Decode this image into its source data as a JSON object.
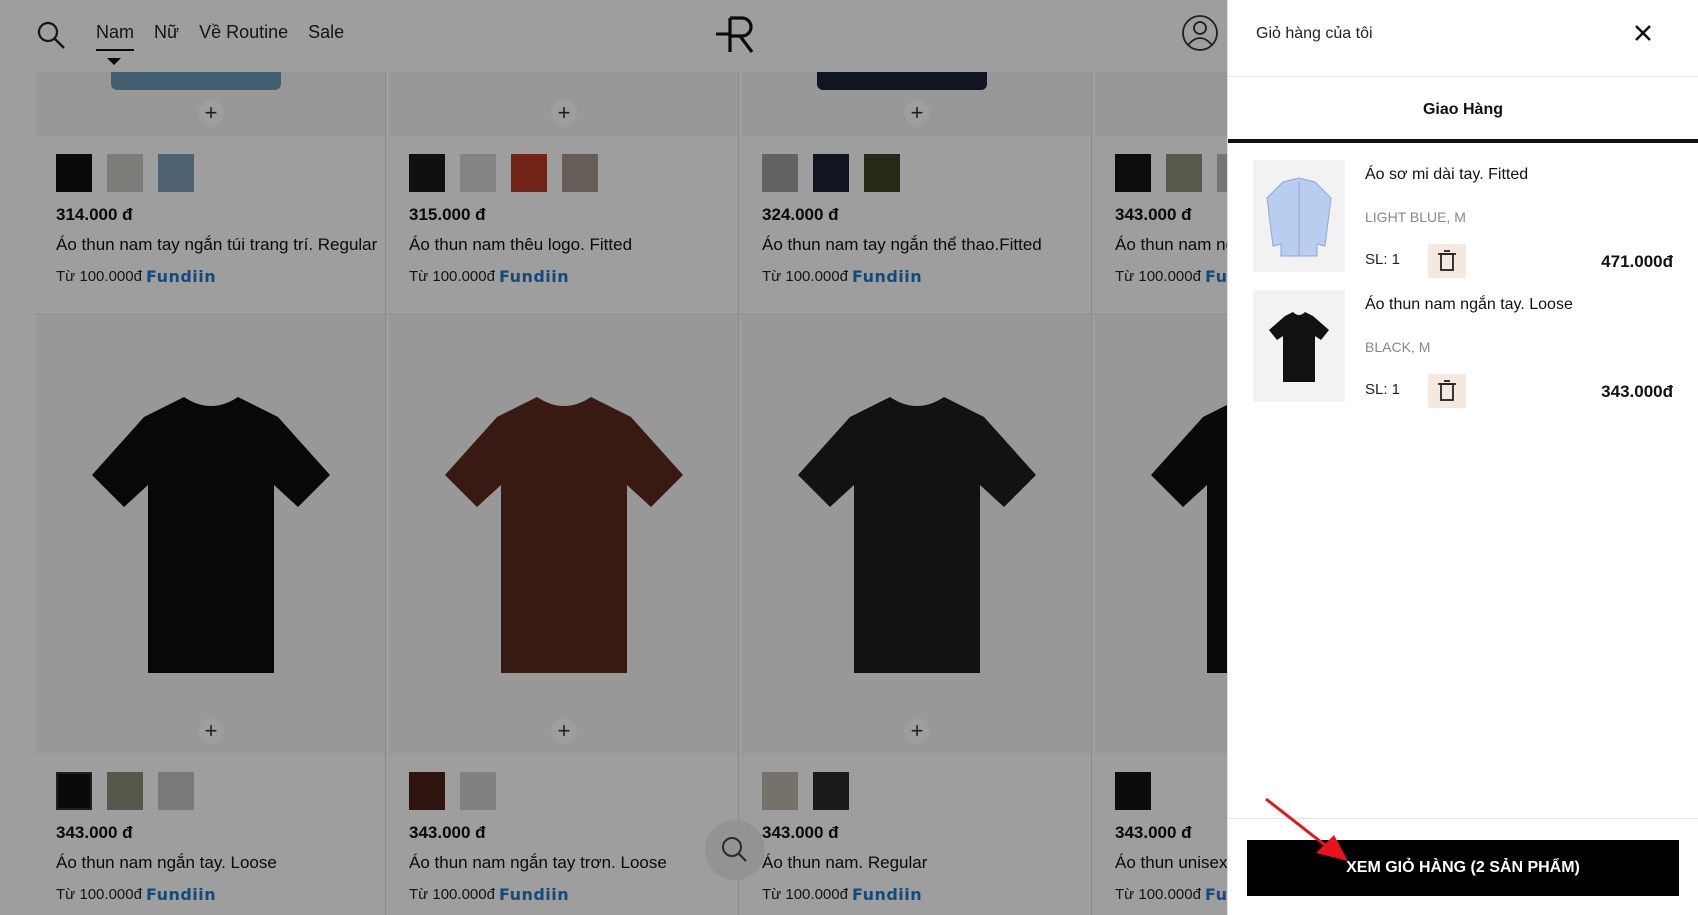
{
  "header": {
    "nav": [
      {
        "label": "Nam",
        "active": true
      },
      {
        "label": "Nữ",
        "active": false
      },
      {
        "label": "Về Routine",
        "active": false
      },
      {
        "label": "Sale",
        "active": false
      }
    ]
  },
  "products_row1": [
    {
      "price": "314.000 đ",
      "name": "Áo thun nam tay ngắn túi trang trí. Regular",
      "installment": "Từ 100.000đ",
      "fundiin": "Fundiin",
      "garment_color": "#6f98b7",
      "swatches": [
        "#111111",
        "#c8c8c4",
        "#7e9fb9"
      ]
    },
    {
      "price": "315.000 đ",
      "name": "Áo thun nam thêu logo. Fitted",
      "installment": "Từ 100.000đ",
      "fundiin": "Fundiin",
      "garment_color": "",
      "swatches": [
        "#1b1b1b",
        "#d6d6d4",
        "#b63a22",
        "#a89890"
      ]
    },
    {
      "price": "324.000 đ",
      "name": "Áo thun nam tay ngắn thể thao.Fitted",
      "installment": "Từ 100.000đ",
      "fundiin": "Fundiin",
      "garment_color": "#1a2236",
      "swatches": [
        "#9fa0a2",
        "#1c2234",
        "#3e4324"
      ]
    },
    {
      "price": "343.000 đ",
      "name": "Áo thun nam ngắn tay. Loose",
      "installment": "Từ 100.000đ",
      "fundiin": "Fundiin",
      "garment_color": "",
      "swatches": [
        "#161616",
        "#8f8f79",
        "#bdbdb8"
      ]
    }
  ],
  "products_row2": [
    {
      "price": "343.000 đ",
      "name": "Áo thun nam ngắn tay. Loose",
      "installment": "Từ 100.000đ",
      "fundiin": "Fundiin",
      "garment_color": "#0e0e0e",
      "swatches": [
        "#111111",
        "#8d8f7a",
        "#c4c5c0"
      ]
    },
    {
      "price": "343.000 đ",
      "name": "Áo thun nam ngắn tay trơn. Loose",
      "installment": "Từ 100.000đ",
      "fundiin": "Fundiin",
      "garment_color": "#5b2b1e",
      "swatches": [
        "#4d2219",
        "#d1d1d1"
      ]
    },
    {
      "price": "343.000 đ",
      "name": "Áo thun nam. Regular",
      "installment": "Từ 100.000đ",
      "fundiin": "Fundiin",
      "garment_color": "#1d1d1d",
      "swatches": [
        "#bdb8ae",
        "#2a2b2e"
      ]
    },
    {
      "price": "343.000 đ",
      "name": "Áo thun unisex. Loose",
      "installment": "Từ 100.000đ",
      "fundiin": "Fundiin",
      "garment_color": "#0f0f0f",
      "swatches": [
        "#141414"
      ]
    }
  ],
  "cart": {
    "title": "Giỏ hàng của tôi",
    "tab": "Giao Hàng",
    "items": [
      {
        "name": "Áo sơ mi dài tay. Fitted",
        "variant": "LIGHT BLUE, M",
        "qty": "SL: 1",
        "price": "471.000đ",
        "color": "#b9cdf0"
      },
      {
        "name": "Áo thun nam ngắn tay. Loose",
        "variant": "BLACK, M",
        "qty": "SL: 1",
        "price": "343.000đ",
        "color": "#111111"
      }
    ],
    "view_cart_label": "XEM GIỎ HÀNG (2 SẢN PHẨM)"
  },
  "colors": {
    "accent": "#000000",
    "overlay": "rgba(0,0,0,0.38)",
    "arrow": "#e8141b"
  }
}
